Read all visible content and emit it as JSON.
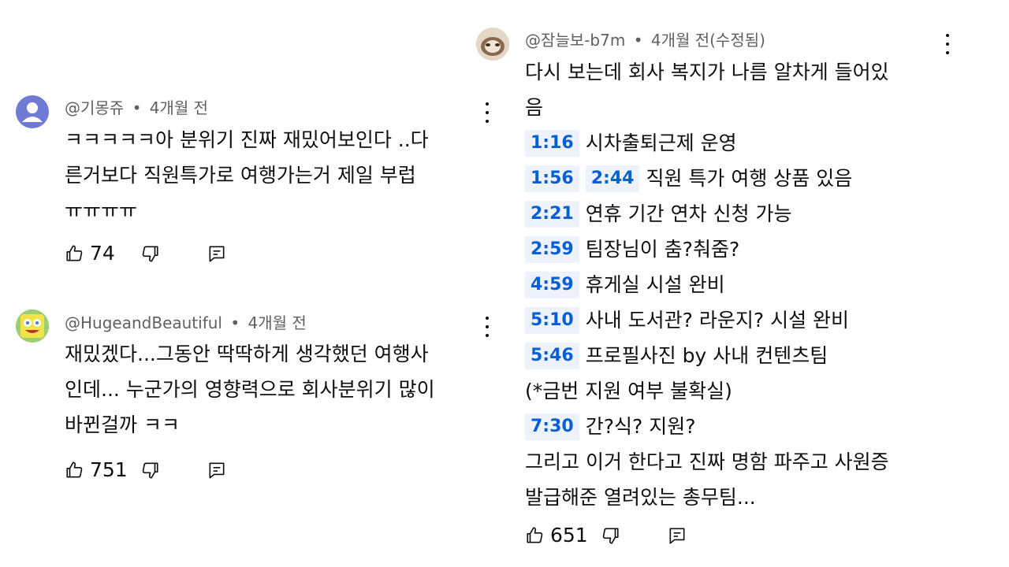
{
  "comments": [
    {
      "author": "@기몽쥬",
      "sep": "•",
      "time": "4개월 전",
      "lines": [
        "ㅋㅋㅋㅋㅋ아 분위기 진짜 재밌어보인다 ..다",
        "른거보다 직원특가로 여행가는거 제일 부럽",
        "ㅠㅠㅠㅠ"
      ],
      "likes": "74"
    },
    {
      "author": "@HugeandBeautiful",
      "sep": "•",
      "time": "4개월 전",
      "lines": [
        "재밌겠다...그동안 딱딱하게 생각했던 여행사",
        "인데... 누군가의 영향력으로 회사분위기 많이",
        "바뀐걸까 ㅋㅋ"
      ],
      "likes": "751"
    },
    {
      "author": "@잠늘보-b7m",
      "sep": "•",
      "time": "4개월 전(수정됨)",
      "intro": [
        "다시 보는데 회사 복지가 나름 알차게 들어있",
        "음"
      ],
      "timestamps": [
        {
          "t1": "1:16",
          "text": "시차출퇴근제 운영"
        },
        {
          "t1": "1:56",
          "t2": "2:44",
          "text": "직원 특가 여행 상품 있음"
        },
        {
          "t1": "2:21",
          "text": "연휴 기간 연차 신청 가능"
        },
        {
          "t1": "2:59",
          "text": "팀장님이 춤?춰줌?"
        },
        {
          "t1": "4:59",
          "text": "휴게실 시설 완비"
        },
        {
          "t1": "5:10",
          "text": "사내 도서관? 라운지? 시설 완비"
        },
        {
          "t1": "5:46",
          "text": "프로필사진 by 사내 컨텐츠팀"
        }
      ],
      "note": "(*금번 지원 여부 불확실)",
      "last_ts": {
        "t1": "7:30",
        "text": "간?식? 지원?"
      },
      "outro": [
        "그리고 이거 한다고 진짜 명함 파주고 사원증",
        "발급해준 열려있는 총무팀..."
      ],
      "likes": "651"
    }
  ],
  "colors": {
    "link": "#065fd4",
    "timestamp_bg": "#eef3fb",
    "meta": "#606060",
    "avatar1": "#6e7ad3"
  },
  "icons": {
    "like": "thumb-up-icon",
    "dislike": "thumb-down-icon",
    "reply": "reply-icon",
    "more": "more-vert-icon"
  }
}
